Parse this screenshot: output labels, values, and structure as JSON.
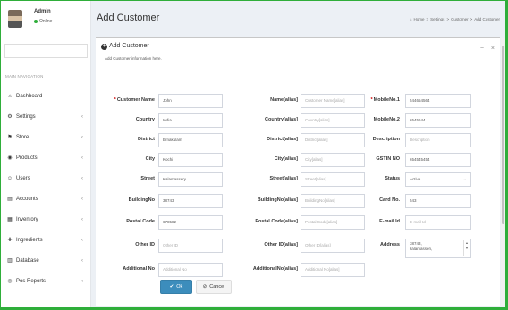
{
  "sidebar": {
    "user": {
      "name": "Admin",
      "status": "Online"
    },
    "nav_header": "MAIN NAVIGATION",
    "items": [
      {
        "label": "Dashboard",
        "icon": "⌂",
        "chev": ""
      },
      {
        "label": "Settings",
        "icon": "⚙",
        "chev": "‹"
      },
      {
        "label": "Store",
        "icon": "⚑",
        "chev": "‹"
      },
      {
        "label": "Products",
        "icon": "◉",
        "chev": "‹"
      },
      {
        "label": "Users",
        "icon": "☺",
        "chev": "‹"
      },
      {
        "label": "Accounts",
        "icon": "▤",
        "chev": "‹"
      },
      {
        "label": "Inventory",
        "icon": "▦",
        "chev": "‹"
      },
      {
        "label": "Ingredients",
        "icon": "✚",
        "chev": "‹"
      },
      {
        "label": "Database",
        "icon": "▥",
        "chev": "‹"
      },
      {
        "label": "Pos Reports",
        "icon": "◎",
        "chev": "‹"
      }
    ]
  },
  "header": {
    "title": "Add Customer",
    "breadcrumb": [
      "Home",
      "Settings",
      "Customer",
      "Add Customer"
    ],
    "home_icon": "⌂",
    "sep": ">"
  },
  "panel": {
    "title": "Add Customer",
    "subtitle": "Add Customer information here.",
    "minimize": "−",
    "close": "×"
  },
  "form": {
    "col1": [
      {
        "label": "Customer Name",
        "value": "John",
        "required": true
      },
      {
        "label": "Country",
        "value": "India"
      },
      {
        "label": "District",
        "value": "Ernakulam"
      },
      {
        "label": "City",
        "value": "Kochi"
      },
      {
        "label": "Street",
        "value": "Kalamassery"
      },
      {
        "label": "BuildingNo",
        "value": "38743"
      },
      {
        "label": "Postal Code",
        "value": "678582"
      },
      {
        "label": "Other ID",
        "placeholder": "Other ID"
      },
      {
        "label": "Additional No",
        "placeholder": "Additional No"
      }
    ],
    "col2": [
      {
        "label": "Name[alias]",
        "placeholder": "Customer Name[alias]"
      },
      {
        "label": "Country[alias]",
        "placeholder": "Country[alias]"
      },
      {
        "label": "District[alias]",
        "placeholder": "District[alias]"
      },
      {
        "label": "City[alias]",
        "placeholder": "City[alias]"
      },
      {
        "label": "Street[alias]",
        "placeholder": "Street[alias]"
      },
      {
        "label": "BuildingNo[alias]",
        "placeholder": "BuildingNo[alias]"
      },
      {
        "label": "Postal Code[alias]",
        "placeholder": "Postal Code[alias]"
      },
      {
        "label": "Other ID[alias]",
        "placeholder": "Other ID[alias]"
      },
      {
        "label": "AdditionalNo[alias]",
        "placeholder": "Additional No[alias]"
      }
    ],
    "col3": [
      {
        "label": "MobileNo.1",
        "value": "544654564",
        "required": true
      },
      {
        "label": "MobileNo.2",
        "value": "6545644"
      },
      {
        "label": "Description",
        "placeholder": "Description"
      },
      {
        "label": "GSTIN NO",
        "value": "654545454"
      },
      {
        "label": "Status",
        "value": "Active"
      },
      {
        "label": "Card No.",
        "value": "543"
      },
      {
        "label": "E-mail Id",
        "placeholder": "E-mail Id"
      },
      {
        "label": "Address",
        "value": "38743,\nkalamasseri,"
      }
    ],
    "ok_label": "Ok",
    "ok_icon": "✔",
    "cancel_label": "Cancel",
    "cancel_icon": "⊘"
  }
}
